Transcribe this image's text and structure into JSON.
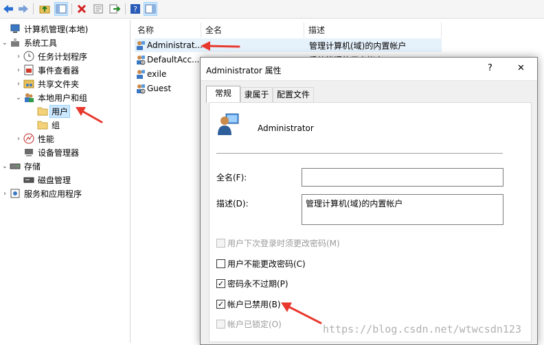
{
  "tree": {
    "items": [
      {
        "label": "计算机管理(本地)",
        "icon": "computer-management-icon"
      },
      {
        "label": "系统工具",
        "icon": "tools-icon"
      },
      {
        "label": "任务计划程序",
        "icon": "clock-icon"
      },
      {
        "label": "事件查看器",
        "icon": "event-viewer-icon"
      },
      {
        "label": "共享文件夹",
        "icon": "shared-folder-icon"
      },
      {
        "label": "本地用户和组",
        "icon": "users-group-icon"
      },
      {
        "label": "用户",
        "icon": "folder-icon"
      },
      {
        "label": "组",
        "icon": "folder-icon"
      },
      {
        "label": "性能",
        "icon": "performance-icon"
      },
      {
        "label": "设备管理器",
        "icon": "device-manager-icon"
      },
      {
        "label": "存储",
        "icon": "storage-icon"
      },
      {
        "label": "磁盘管理",
        "icon": "disk-icon"
      },
      {
        "label": "服务和应用程序",
        "icon": "services-icon"
      }
    ]
  },
  "list": {
    "columns": [
      "名称",
      "全名",
      "描述"
    ],
    "rows": [
      {
        "name": "Administrat...",
        "fullname": "",
        "description": "管理计算机(域)的内置帐户"
      },
      {
        "name": "DefaultAcc...",
        "fullname": "",
        "description": "系统管理的用户帐户"
      },
      {
        "name": "exile",
        "fullname": "",
        "description": ""
      },
      {
        "name": "Guest",
        "fullname": "",
        "description": ""
      }
    ]
  },
  "dialog": {
    "title": "Administrator 属性",
    "help": "?",
    "close": "✕",
    "tabs": [
      "常规",
      "隶属于",
      "配置文件"
    ],
    "username": "Administrator",
    "fullname_label": "全名(F):",
    "fullname_value": "",
    "description_label": "描述(D):",
    "description_value": "管理计算机(域)的内置帐户",
    "checkboxes": [
      {
        "label": "用户下次登录时须更改密码(M)",
        "checked": false,
        "disabled": true
      },
      {
        "label": "用户不能更改密码(C)",
        "checked": false,
        "disabled": false
      },
      {
        "label": "密码永不过期(P)",
        "checked": true,
        "disabled": false
      },
      {
        "label": "帐户已禁用(B)",
        "checked": true,
        "disabled": false
      },
      {
        "label": "帐户已锁定(O)",
        "checked": false,
        "disabled": true
      }
    ]
  },
  "watermark": "https://blog.csdn.net/wtwcsdn123",
  "colors": {
    "arrow": "#e8392f",
    "selection": "#cce8ff",
    "check": "#000000"
  }
}
